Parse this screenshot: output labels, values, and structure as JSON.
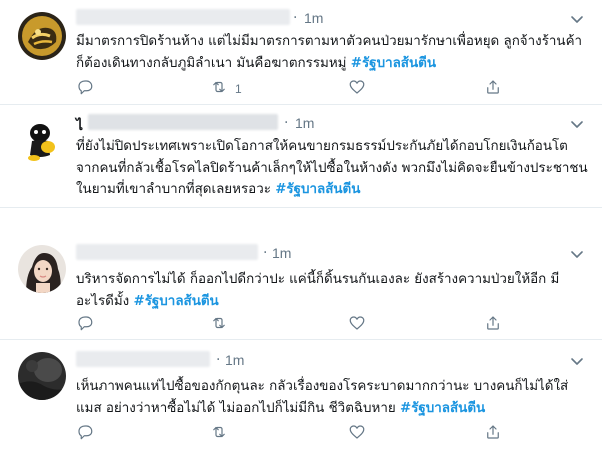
{
  "tweets": [
    {
      "time": "1m",
      "dot": "·",
      "text": "มีมาตรการปิดร้านห้าง แต่ไม่มีมาตรการตามหาตัวคนป่วยมารักษาเพื่อหยุด ลูกจ้างร้านค้าก็ต้องเดินทางกลับภูมิลำเนา มันคือฆาตกรรมหมู่",
      "hashtag": "#รัฐบาลส้นตีน",
      "retweet_count": "1"
    },
    {
      "time": "1m",
      "dot": "·",
      "name_visible": "ไ",
      "text": "ที่ยังไม่ปิดประเทศเพราะเปิดโอกาสให้คนขายกรมธรรม์ประกันภัยได้กอบโกยเงินก้อนโตจากคนที่กลัวเชื้อโรคไลปิดร้านค้าเล็กๆให้ไปซื้อในห้างดัง พวกมึงไม่คิดจะยืนข้างประชาชนในยามที่เขาลำบากที่สุดเลยหรอวะ",
      "hashtag": "#รัฐบาลส้นตีน",
      "retweet_count": ""
    },
    {
      "time": "1m",
      "dot": "·",
      "text": "บริหารจัดการไม่ได้ ก็ออกไปดีกว่าปะ แค่นี้ก็ดิ้นรนกันเองละ ยังสร้างความป่วยให้อีก มีอะไรดีมั้ง",
      "hashtag": "#รัฐบาลส้นตีน",
      "retweet_count": ""
    },
    {
      "time": "1m",
      "dot": "·",
      "text": "เห็นภาพคนแห่ไปซื้อของกักตุนละ กลัวเรื่องของโรคระบาดมากกว่านะ บางคนก็ไม่ได้ใส่แมส อย่างว่าหาซื้อไม่ได้ ไม่ออกไปก็ไม่มีกิน ชีวิตฉิบหาย",
      "hashtag": "#รัฐบาลส้นตีน",
      "retweet_count": ""
    }
  ],
  "icons": {
    "reply": "reply-icon",
    "retweet": "retweet-icon",
    "like": "like-icon",
    "share": "share-icon",
    "more": "chevron-down-icon"
  },
  "colors": {
    "hashtag": "#1b95e0",
    "icon": "#657786",
    "divider": "#e6ecf0"
  }
}
